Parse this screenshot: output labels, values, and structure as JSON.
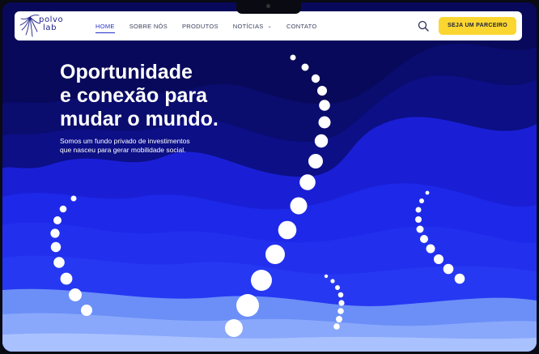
{
  "brand": {
    "logo_line1": "polvo",
    "logo_line2": "lab"
  },
  "nav": {
    "items": [
      {
        "label": "HOME",
        "active": true
      },
      {
        "label": "SOBRE NÓS",
        "active": false
      },
      {
        "label": "PRODUTOS",
        "active": false
      },
      {
        "label": "NOTÍCIAS",
        "active": false,
        "dropdown": true
      },
      {
        "label": "CONTATO",
        "active": false
      }
    ],
    "search_icon": "search-icon",
    "cta_label": "SEJA UM PARCEIRO"
  },
  "hero": {
    "title_lines": [
      "Oportunidade",
      "e conexão para",
      "mudar o mundo."
    ],
    "subtitle_lines": [
      "Somos um fundo privado de investimentos",
      "que nasceu para gerar mobilidade social."
    ]
  },
  "colors": {
    "accent": "#fbd631",
    "nav_active": "#2731c9",
    "background": "#1a1fd6",
    "text_on_hero": "#ffffff"
  }
}
